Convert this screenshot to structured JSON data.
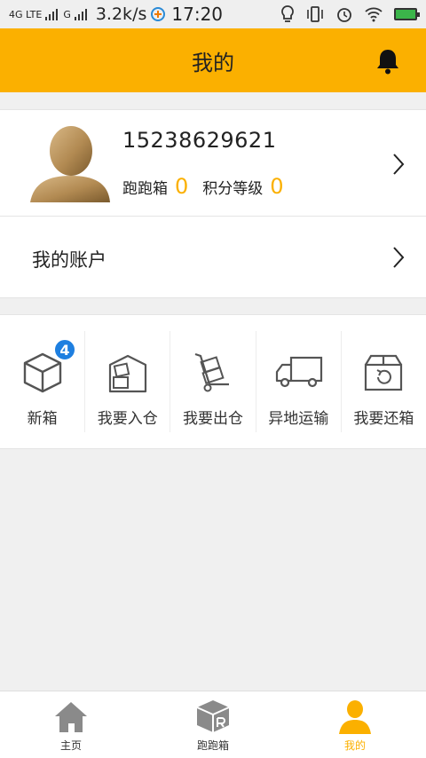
{
  "status_bar": {
    "network_1": "4G LTE",
    "network_2": "G",
    "speed": "3.2k/s",
    "time": "17:20"
  },
  "header": {
    "title": "我的"
  },
  "profile": {
    "phone": "15238629621",
    "box_label": "跑跑箱",
    "box_count": "0",
    "points_label": "积分等级",
    "points_level": "0"
  },
  "account": {
    "label": "我的账户"
  },
  "actions": [
    {
      "label": "新箱",
      "icon": "cube-icon",
      "badge": "4"
    },
    {
      "label": "我要入仓",
      "icon": "warehouse-in-icon"
    },
    {
      "label": "我要出仓",
      "icon": "hand-truck-icon"
    },
    {
      "label": "异地运输",
      "icon": "truck-icon"
    },
    {
      "label": "我要还箱",
      "icon": "return-box-icon"
    }
  ],
  "tabbar": [
    {
      "label": "主页",
      "icon": "home-icon",
      "active": false
    },
    {
      "label": "跑跑箱",
      "icon": "box-icon",
      "active": false
    },
    {
      "label": "我的",
      "icon": "person-icon",
      "active": true
    }
  ],
  "colors": {
    "accent": "#fbb000",
    "badge": "#1e7fe0"
  }
}
